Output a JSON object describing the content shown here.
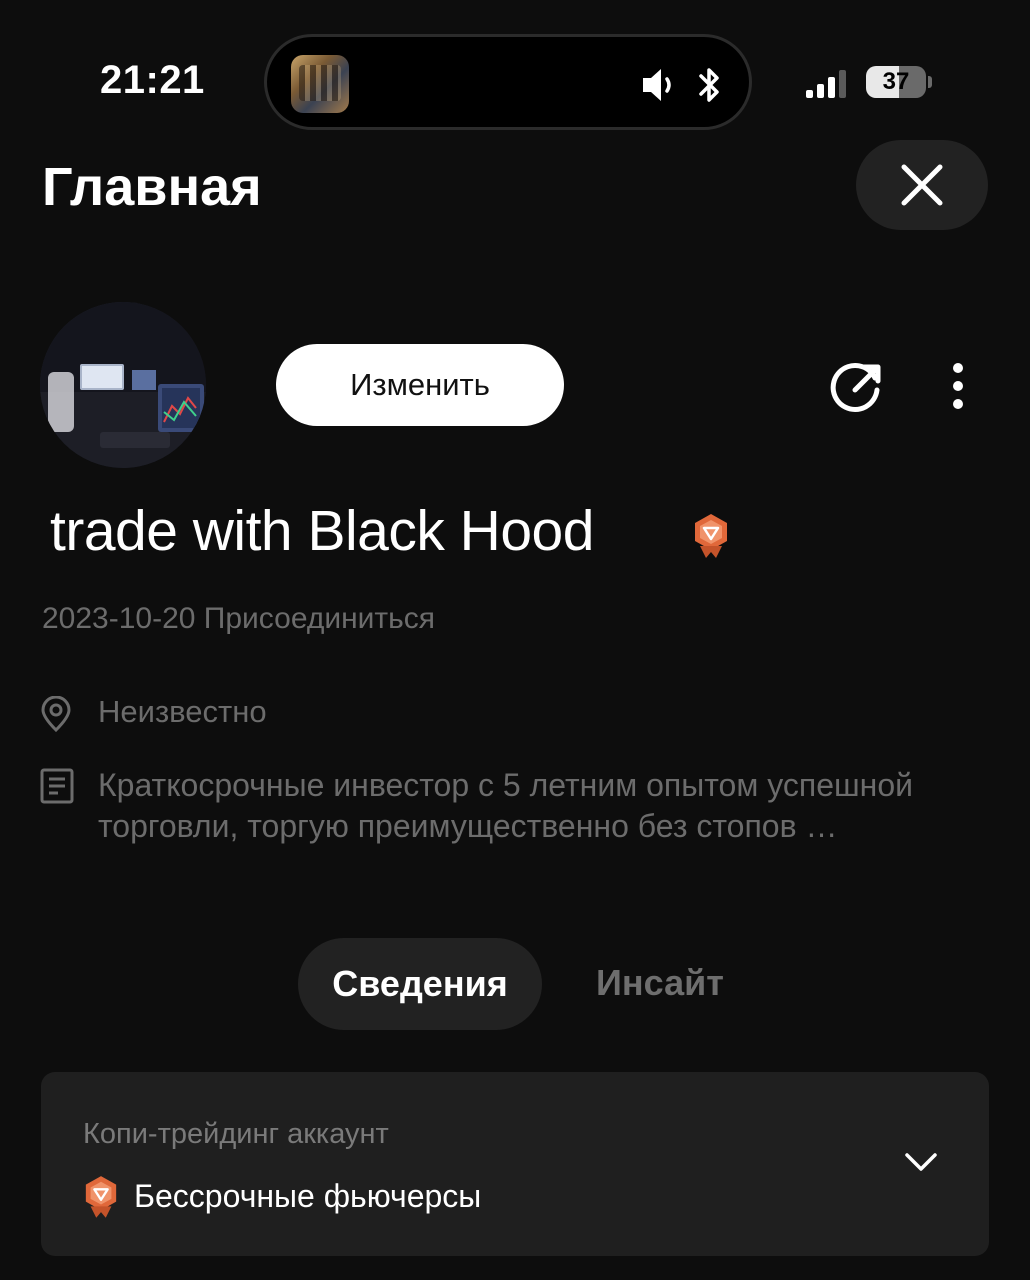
{
  "status_bar": {
    "time": "21:21",
    "battery": "37"
  },
  "header": {
    "title": "Главная"
  },
  "profile": {
    "edit_label": "Изменить",
    "username": "trade with Black Hood",
    "joined": "2023-10-20 Присоединиться",
    "location": "Неизвестно",
    "bio": "Краткосрочные инвестор с 5 летним опытом успешной торговли, торгую преимущественно без стопов …"
  },
  "tabs": [
    {
      "label": "Сведения",
      "active": true
    },
    {
      "label": "Инсайт",
      "active": false
    }
  ],
  "account_card": {
    "label": "Копи-трейдинг аккаунт",
    "value": "Бессрочные фьючерсы"
  },
  "colors": {
    "background": "#0d0d0d",
    "surface": "#1f1f1f",
    "muted_text": "#6c6c6c",
    "badge": "#e0683a"
  },
  "icons": {
    "close": "close-icon",
    "share": "share-icon",
    "more": "more-vertical-icon",
    "location": "location-pin-icon",
    "bio": "document-icon",
    "badge": "copy-trader-badge-icon",
    "chevron": "chevron-down-icon"
  }
}
